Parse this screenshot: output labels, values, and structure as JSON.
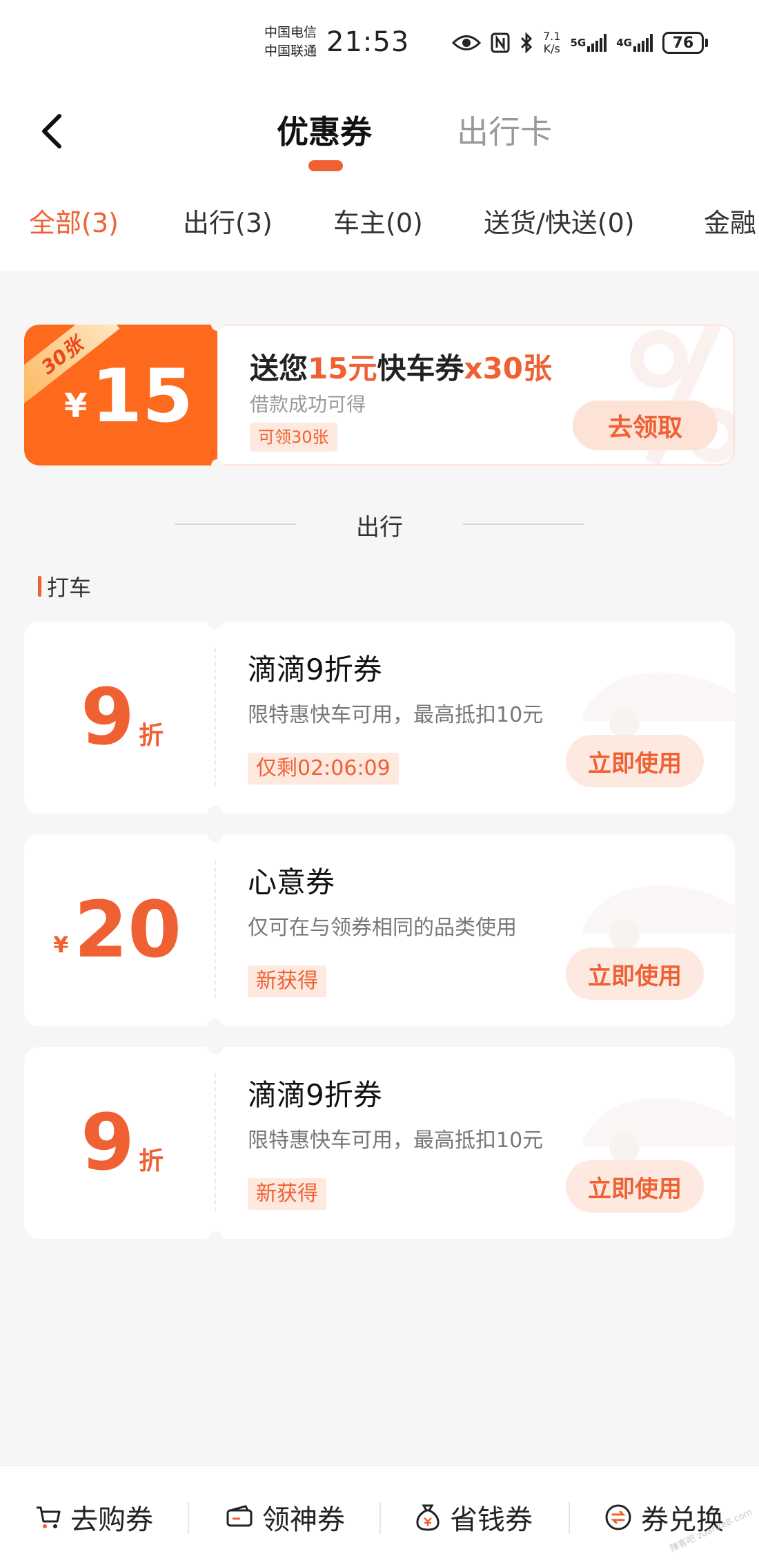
{
  "status_bar": {
    "carrier1": "中国电信",
    "carrier2": "中国联通",
    "time": "21:53",
    "net_speed_value": "7.1",
    "net_speed_unit": "K/s",
    "sim1_label": "5G",
    "sim2_label": "4G",
    "battery": "76"
  },
  "header": {
    "tabs": [
      "优惠券",
      "出行卡"
    ],
    "active_tab": "优惠券"
  },
  "category_tabs": [
    "全部(3)",
    "出行(3)",
    "车主(0)",
    "送货/快送(0)",
    "金融"
  ],
  "banner": {
    "corner_badge": "30张",
    "currency": "¥",
    "amount": "15",
    "title_prefix": "送您",
    "title_highlight1": "15元",
    "title_middle": "快车券",
    "title_highlight2": "x30张",
    "subtitle": "借款成功可得",
    "chip": "可领30张",
    "button": "去领取"
  },
  "section_title": "出行",
  "subsection_title": "打车",
  "coupons": [
    {
      "value": "9",
      "unit": "折",
      "currency": "",
      "title": "滴滴9折券",
      "desc": "限特惠快车可用，最高抵扣10元",
      "tag": "仅剩02:06:09",
      "button": "立即使用"
    },
    {
      "value": "20",
      "unit": "",
      "currency": "¥",
      "title": "心意券",
      "desc": "仅可在与领券相同的品类使用",
      "tag": "新获得",
      "button": "立即使用"
    },
    {
      "value": "9",
      "unit": "折",
      "currency": "",
      "title": "滴滴9折券",
      "desc": "限特惠快车可用，最高抵扣10元",
      "tag": "新获得",
      "button": "立即使用"
    }
  ],
  "bottom_nav": [
    {
      "label": "去购券",
      "icon": "cart-icon"
    },
    {
      "label": "领神券",
      "icon": "ticket-icon"
    },
    {
      "label": "省钱券",
      "icon": "money-bag-icon"
    },
    {
      "label": "券兑换",
      "icon": "exchange-icon"
    }
  ],
  "watermark": "赚客吧 zuanke8.com",
  "colors": {
    "accent": "#ef6133",
    "banner": "#fd6a1e",
    "tag_bg": "#fde9df"
  }
}
